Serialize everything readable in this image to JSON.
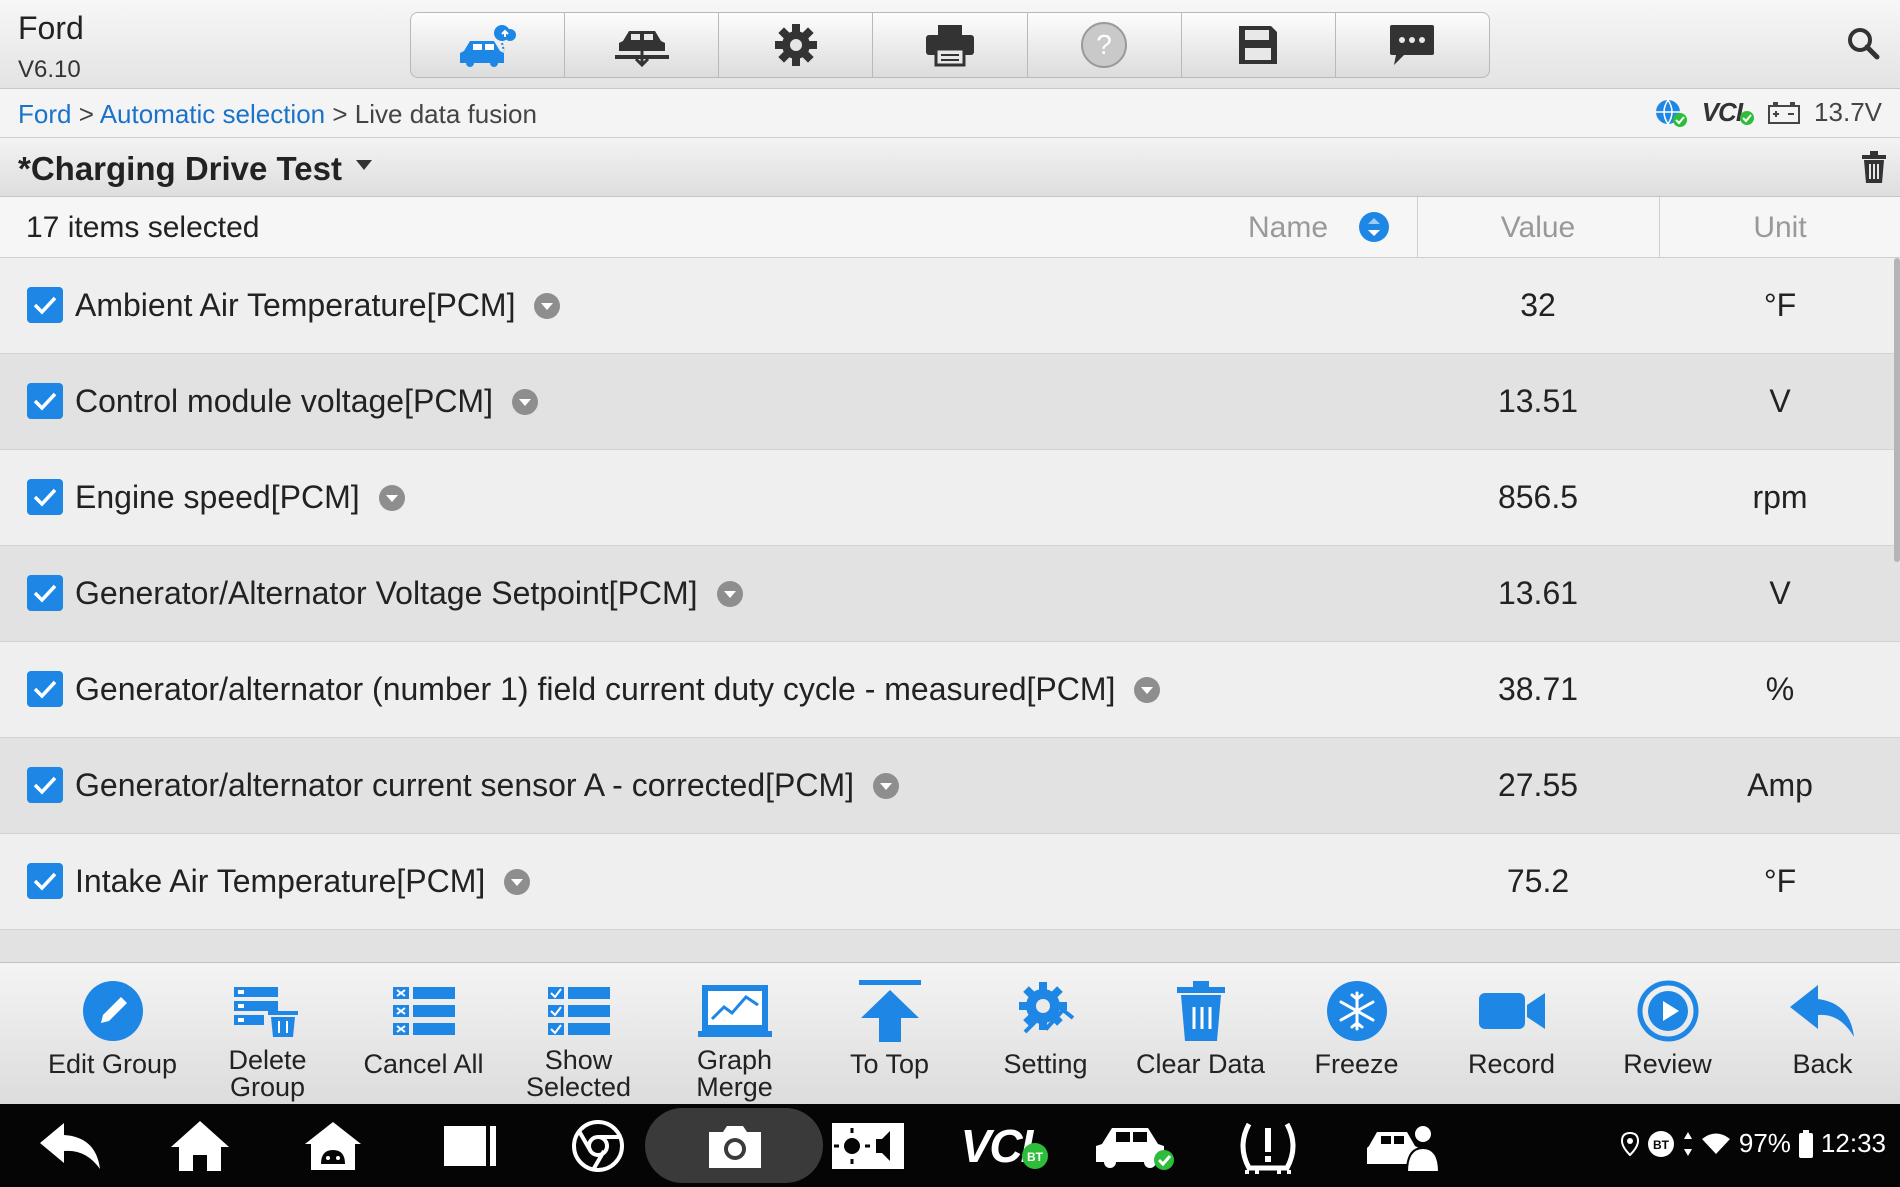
{
  "app": {
    "title": "Ford",
    "version": "V6.10"
  },
  "toolbar": {
    "items": [
      {
        "icon": "car-cloud-icon"
      },
      {
        "icon": "car-lift-icon"
      },
      {
        "icon": "gear-icon"
      },
      {
        "icon": "printer-icon"
      },
      {
        "icon": "help-icon"
      },
      {
        "icon": "save-icon"
      },
      {
        "icon": "message-icon"
      }
    ],
    "search_icon": "search-icon"
  },
  "breadcrumb": {
    "items": [
      "Ford",
      "Automatic selection"
    ],
    "separator": ">",
    "current": "Live data fusion"
  },
  "status": {
    "vci": "VCI",
    "voltage": "13.7V"
  },
  "group": {
    "title": "*Charging Drive Test"
  },
  "table": {
    "selected_count": "17 items selected",
    "columns": {
      "name": "Name",
      "value": "Value",
      "unit": "Unit"
    },
    "rows": [
      {
        "name": "Ambient Air Temperature[PCM]",
        "value": "32",
        "unit": "°F"
      },
      {
        "name": "Control module voltage[PCM]",
        "value": "13.51",
        "unit": "V"
      },
      {
        "name": "Engine speed[PCM]",
        "value": "856.5",
        "unit": "rpm"
      },
      {
        "name": "Generator/Alternator Voltage Setpoint[PCM]",
        "value": "13.61",
        "unit": "V"
      },
      {
        "name": "Generator/alternator (number 1) field current duty cycle - measured[PCM]",
        "value": "38.71",
        "unit": "%"
      },
      {
        "name": "Generator/alternator current sensor A - corrected[PCM]",
        "value": "27.55",
        "unit": "Amp"
      },
      {
        "name": "Intake Air Temperature[PCM]",
        "value": "75.2",
        "unit": "°F"
      }
    ]
  },
  "actions": {
    "edit_group": {
      "line1": "Edit Group",
      "line2": ""
    },
    "delete_group": {
      "line1": "Delete",
      "line2": "Group"
    },
    "cancel_all": {
      "line1": "Cancel All",
      "line2": ""
    },
    "show_selected": {
      "line1": "Show",
      "line2": "Selected"
    },
    "graph_merge": {
      "line1": "Graph",
      "line2": "Merge"
    },
    "to_top": {
      "line1": "To Top",
      "line2": ""
    },
    "setting": {
      "line1": "Setting",
      "line2": ""
    },
    "clear_data": {
      "line1": "Clear Data",
      "line2": ""
    },
    "freeze": {
      "line1": "Freeze",
      "line2": ""
    },
    "record": {
      "line1": "Record",
      "line2": ""
    },
    "review": {
      "line1": "Review",
      "line2": ""
    },
    "back": {
      "line1": "Back",
      "line2": ""
    }
  },
  "system": {
    "battery": "97%",
    "time": "12:33",
    "vci": "VCI",
    "bt": "BT"
  },
  "colors": {
    "accent": "#1e87e5",
    "link": "#1a73c8",
    "system_bar": "#050505"
  }
}
